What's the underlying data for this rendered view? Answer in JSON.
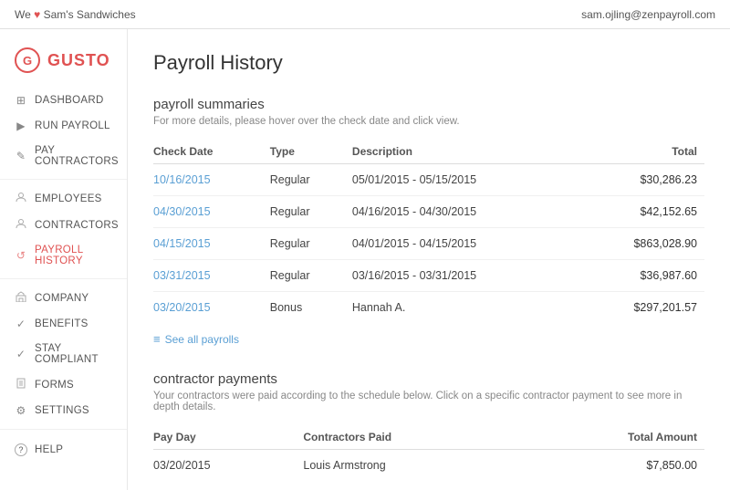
{
  "topbar": {
    "we_label": "We",
    "heart": "♥",
    "company_name": "Sam's Sandwiches",
    "user_email": "sam.ojling@zenpayroll.com"
  },
  "sidebar": {
    "logo_letter": "G",
    "logo_text": "GUSTO",
    "nav_items": [
      {
        "id": "dashboard",
        "label": "DASHBOARD",
        "icon": "⊞"
      },
      {
        "id": "run-payroll",
        "label": "RUN PAYROLL",
        "icon": "▶"
      },
      {
        "id": "pay-contractors",
        "label": "PAY CONTRACTORS",
        "icon": "✎"
      }
    ],
    "nav_items2": [
      {
        "id": "employees",
        "label": "EMPLOYEES",
        "icon": "👤"
      },
      {
        "id": "contractors",
        "label": "CONTRACTORS",
        "icon": "👤"
      },
      {
        "id": "payroll-history",
        "label": "PAYROLL HISTORY",
        "icon": "↺",
        "active": true
      }
    ],
    "nav_items3": [
      {
        "id": "company",
        "label": "COMPANY",
        "icon": "🏢"
      },
      {
        "id": "benefits",
        "label": "BENEFITS",
        "icon": "✓"
      },
      {
        "id": "stay-compliant",
        "label": "STAY COMPLIANT",
        "icon": "✓"
      },
      {
        "id": "forms",
        "label": "FORMS",
        "icon": "☰"
      },
      {
        "id": "settings",
        "label": "SETTINGS",
        "icon": "⚙"
      }
    ],
    "help_label": "HELP",
    "help_icon": "?"
  },
  "main": {
    "page_title": "Payroll History",
    "payroll_section": {
      "title": "payroll summaries",
      "subtitle": "For more details, please hover over the check date and click view.",
      "columns": [
        "Check Date",
        "Type",
        "Description",
        "Total"
      ],
      "rows": [
        {
          "check_date": "10/16/2015",
          "type": "Regular",
          "description": "05/01/2015 - 05/15/2015",
          "total": "$30,286.23"
        },
        {
          "check_date": "04/30/2015",
          "type": "Regular",
          "description": "04/16/2015 - 04/30/2015",
          "total": "$42,152.65"
        },
        {
          "check_date": "04/15/2015",
          "type": "Regular",
          "description": "04/01/2015 - 04/15/2015",
          "total": "$863,028.90"
        },
        {
          "check_date": "03/31/2015",
          "type": "Regular",
          "description": "03/16/2015 - 03/31/2015",
          "total": "$36,987.60"
        },
        {
          "check_date": "03/20/2015",
          "type": "Bonus",
          "description": "Hannah A.",
          "total": "$297,201.57"
        }
      ],
      "see_all_label": "See all payrolls"
    },
    "contractor_section": {
      "title": "contractor payments",
      "subtitle": "Your contractors were paid according to the schedule below. Click on a specific contractor payment to see more in depth details.",
      "columns": [
        "Pay Day",
        "Contractors Paid",
        "Total Amount"
      ],
      "rows": [
        {
          "pay_day": "03/20/2015",
          "contractors_paid": "Louis Armstrong",
          "total_amount": "$7,850.00"
        }
      ]
    }
  }
}
